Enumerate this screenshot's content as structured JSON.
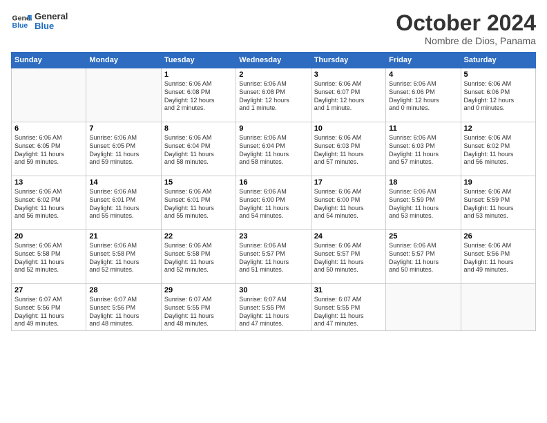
{
  "header": {
    "logo_general": "General",
    "logo_blue": "Blue",
    "month": "October 2024",
    "location": "Nombre de Dios, Panama"
  },
  "weekdays": [
    "Sunday",
    "Monday",
    "Tuesday",
    "Wednesday",
    "Thursday",
    "Friday",
    "Saturday"
  ],
  "weeks": [
    [
      {
        "day": "",
        "info": ""
      },
      {
        "day": "",
        "info": ""
      },
      {
        "day": "1",
        "info": "Sunrise: 6:06 AM\nSunset: 6:08 PM\nDaylight: 12 hours\nand 2 minutes."
      },
      {
        "day": "2",
        "info": "Sunrise: 6:06 AM\nSunset: 6:08 PM\nDaylight: 12 hours\nand 1 minute."
      },
      {
        "day": "3",
        "info": "Sunrise: 6:06 AM\nSunset: 6:07 PM\nDaylight: 12 hours\nand 1 minute."
      },
      {
        "day": "4",
        "info": "Sunrise: 6:06 AM\nSunset: 6:06 PM\nDaylight: 12 hours\nand 0 minutes."
      },
      {
        "day": "5",
        "info": "Sunrise: 6:06 AM\nSunset: 6:06 PM\nDaylight: 12 hours\nand 0 minutes."
      }
    ],
    [
      {
        "day": "6",
        "info": "Sunrise: 6:06 AM\nSunset: 6:05 PM\nDaylight: 11 hours\nand 59 minutes."
      },
      {
        "day": "7",
        "info": "Sunrise: 6:06 AM\nSunset: 6:05 PM\nDaylight: 11 hours\nand 59 minutes."
      },
      {
        "day": "8",
        "info": "Sunrise: 6:06 AM\nSunset: 6:04 PM\nDaylight: 11 hours\nand 58 minutes."
      },
      {
        "day": "9",
        "info": "Sunrise: 6:06 AM\nSunset: 6:04 PM\nDaylight: 11 hours\nand 58 minutes."
      },
      {
        "day": "10",
        "info": "Sunrise: 6:06 AM\nSunset: 6:03 PM\nDaylight: 11 hours\nand 57 minutes."
      },
      {
        "day": "11",
        "info": "Sunrise: 6:06 AM\nSunset: 6:03 PM\nDaylight: 11 hours\nand 57 minutes."
      },
      {
        "day": "12",
        "info": "Sunrise: 6:06 AM\nSunset: 6:02 PM\nDaylight: 11 hours\nand 56 minutes."
      }
    ],
    [
      {
        "day": "13",
        "info": "Sunrise: 6:06 AM\nSunset: 6:02 PM\nDaylight: 11 hours\nand 56 minutes."
      },
      {
        "day": "14",
        "info": "Sunrise: 6:06 AM\nSunset: 6:01 PM\nDaylight: 11 hours\nand 55 minutes."
      },
      {
        "day": "15",
        "info": "Sunrise: 6:06 AM\nSunset: 6:01 PM\nDaylight: 11 hours\nand 55 minutes."
      },
      {
        "day": "16",
        "info": "Sunrise: 6:06 AM\nSunset: 6:00 PM\nDaylight: 11 hours\nand 54 minutes."
      },
      {
        "day": "17",
        "info": "Sunrise: 6:06 AM\nSunset: 6:00 PM\nDaylight: 11 hours\nand 54 minutes."
      },
      {
        "day": "18",
        "info": "Sunrise: 6:06 AM\nSunset: 5:59 PM\nDaylight: 11 hours\nand 53 minutes."
      },
      {
        "day": "19",
        "info": "Sunrise: 6:06 AM\nSunset: 5:59 PM\nDaylight: 11 hours\nand 53 minutes."
      }
    ],
    [
      {
        "day": "20",
        "info": "Sunrise: 6:06 AM\nSunset: 5:58 PM\nDaylight: 11 hours\nand 52 minutes."
      },
      {
        "day": "21",
        "info": "Sunrise: 6:06 AM\nSunset: 5:58 PM\nDaylight: 11 hours\nand 52 minutes."
      },
      {
        "day": "22",
        "info": "Sunrise: 6:06 AM\nSunset: 5:58 PM\nDaylight: 11 hours\nand 52 minutes."
      },
      {
        "day": "23",
        "info": "Sunrise: 6:06 AM\nSunset: 5:57 PM\nDaylight: 11 hours\nand 51 minutes."
      },
      {
        "day": "24",
        "info": "Sunrise: 6:06 AM\nSunset: 5:57 PM\nDaylight: 11 hours\nand 50 minutes."
      },
      {
        "day": "25",
        "info": "Sunrise: 6:06 AM\nSunset: 5:57 PM\nDaylight: 11 hours\nand 50 minutes."
      },
      {
        "day": "26",
        "info": "Sunrise: 6:06 AM\nSunset: 5:56 PM\nDaylight: 11 hours\nand 49 minutes."
      }
    ],
    [
      {
        "day": "27",
        "info": "Sunrise: 6:07 AM\nSunset: 5:56 PM\nDaylight: 11 hours\nand 49 minutes."
      },
      {
        "day": "28",
        "info": "Sunrise: 6:07 AM\nSunset: 5:56 PM\nDaylight: 11 hours\nand 48 minutes."
      },
      {
        "day": "29",
        "info": "Sunrise: 6:07 AM\nSunset: 5:55 PM\nDaylight: 11 hours\nand 48 minutes."
      },
      {
        "day": "30",
        "info": "Sunrise: 6:07 AM\nSunset: 5:55 PM\nDaylight: 11 hours\nand 47 minutes."
      },
      {
        "day": "31",
        "info": "Sunrise: 6:07 AM\nSunset: 5:55 PM\nDaylight: 11 hours\nand 47 minutes."
      },
      {
        "day": "",
        "info": ""
      },
      {
        "day": "",
        "info": ""
      }
    ]
  ]
}
